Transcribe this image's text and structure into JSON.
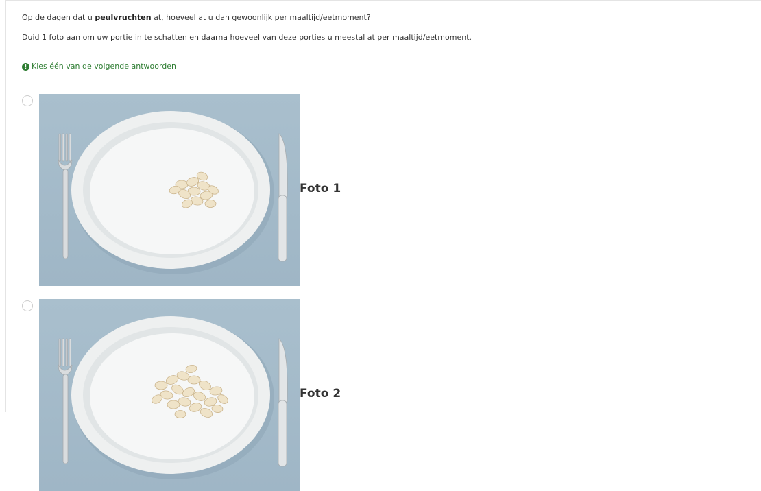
{
  "question": {
    "prefix": "Op de dagen dat u ",
    "bold": "peulvruchten",
    "suffix": " at, hoeveel at u dan gewoonlijk per maaltijd/eetmoment?"
  },
  "help_text": "Duid 1 foto aan om uw portie in te schatten en daarna hoeveel van deze porties u meestal at per maaltijd/eetmoment.",
  "tip": {
    "icon": "info-icon",
    "text": "Kies één van de volgende antwoorden"
  },
  "options": [
    {
      "label": "Foto 1",
      "selected": false,
      "portion": "small"
    },
    {
      "label": "Foto 2",
      "selected": false,
      "portion": "medium"
    }
  ],
  "colors": {
    "tip_green": "#2e7d32",
    "photo_background": "#a9bfcd",
    "plate": "#f4f5f5"
  }
}
